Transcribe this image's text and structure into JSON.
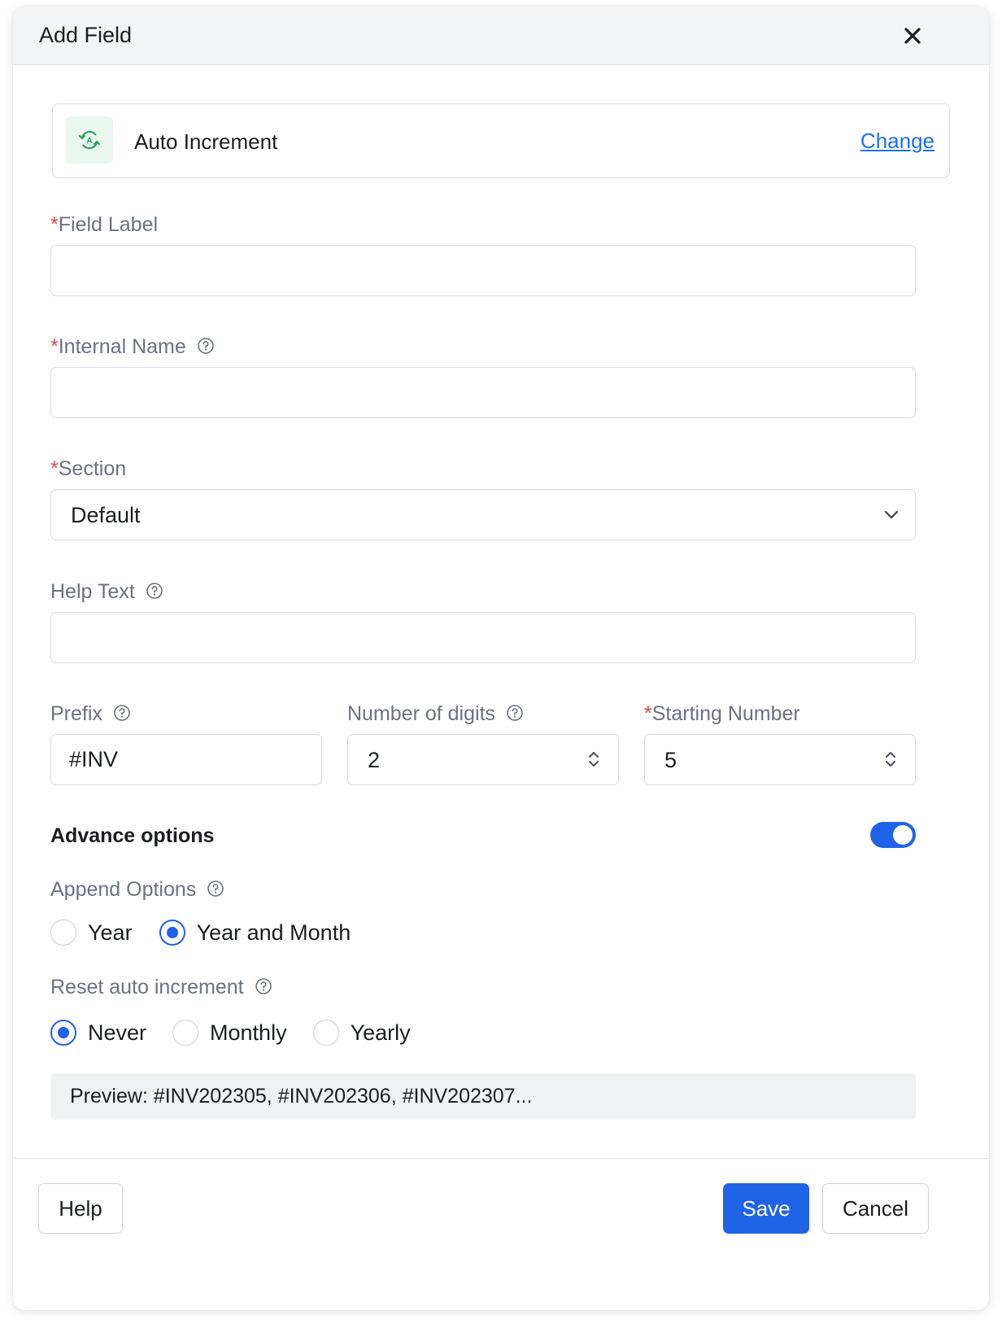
{
  "dialog": {
    "title": "Add Field"
  },
  "field_type": {
    "name": "Auto Increment",
    "change_label": "Change",
    "icon": "auto-increment-icon"
  },
  "form": {
    "field_label": {
      "label": "Field Label",
      "value": ""
    },
    "internal_name": {
      "label": "Internal Name",
      "value": ""
    },
    "section": {
      "label": "Section",
      "value": "Default"
    },
    "help_text": {
      "label": "Help Text",
      "value": ""
    },
    "prefix": {
      "label": "Prefix",
      "value": "#INV"
    },
    "number_of_digits": {
      "label": "Number of digits",
      "value": "2"
    },
    "starting_number": {
      "label": "Starting Number",
      "value": "5"
    },
    "required_marker": "*"
  },
  "advance": {
    "title": "Advance options",
    "enabled": true,
    "append_options": {
      "label": "Append Options",
      "options": [
        "Year",
        "Year and Month"
      ],
      "selected": "Year and Month"
    },
    "reset": {
      "label": "Reset auto increment",
      "options": [
        "Never",
        "Monthly",
        "Yearly"
      ],
      "selected": "Never"
    },
    "preview": "Preview: #INV202305, #INV202306, #INV202307..."
  },
  "footer": {
    "help_label": "Help",
    "save_label": "Save",
    "cancel_label": "Cancel"
  },
  "colors": {
    "primary": "#1f63e6",
    "required": "#e5484d",
    "link": "#1a73e8",
    "icon_green": "#22a05a"
  }
}
